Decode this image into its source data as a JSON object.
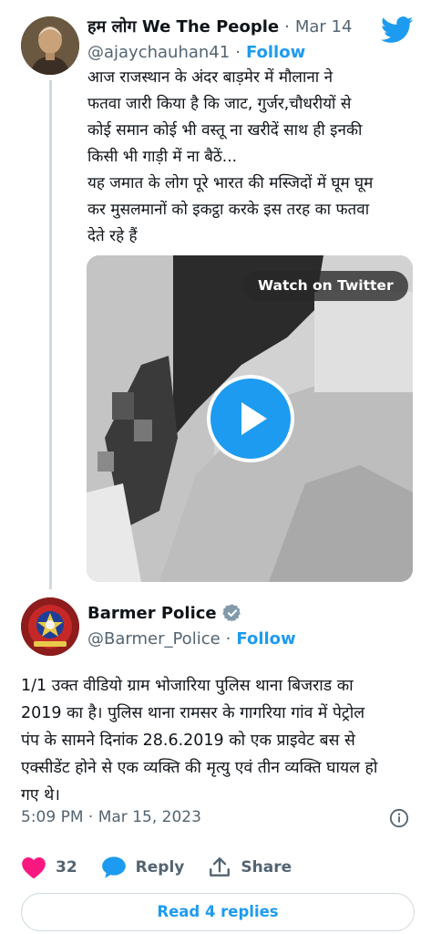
{
  "colors": {
    "brand": "#1d9bf0",
    "text": "#0f1419",
    "secondary": "#536471",
    "like": "#f91880",
    "border": "#cfd9de"
  },
  "icons": {
    "logo": "twitter-bird-icon",
    "verified": "verified-badge-icon",
    "info": "info-icon",
    "like": "heart-icon",
    "reply": "speech-bubble-icon",
    "share": "share-upload-icon",
    "play": "play-icon"
  },
  "quoted_tweet": {
    "display_name": "हम लोग We The People",
    "separator": "·",
    "date": "Mar 14",
    "handle": "@ajaychauhan41",
    "handle_separator": "·",
    "follow_label": "Follow",
    "text": "आज  राजस्थान के अंदर बाड़मेर में मौलाना ने\nफतवा जारी किया है कि जाट, गुर्जर,चौधरीयों से\nकोई समान कोई भी वस्तू ना खरीदें साथ ही इनकी\nकिसी भी गाड़ी में ना बैठें...\n यह जमात के लोग पूरे भारत की मस्जिदों में घूम घूम\nकर मुसलमानों को इकट्ठा करके इस तरह का फतवा\nदेते रहे हैं",
    "video": {
      "watch_label": "Watch on Twitter"
    }
  },
  "reply_tweet": {
    "display_name": "Barmer Police",
    "handle": "@Barmer_Police",
    "handle_separator": "·",
    "follow_label": "Follow",
    "text": "1/1 उक्त वीडियो ग्राम भोजारिया पुलिस थाना बिजराड का\n2019 का है। पुलिस थाना रामसर के गागरिया गांव में पेट्रोल\nपंप के सामने दिनांक 28.6.2019 को एक प्राइवेट बस से\nएक्सीडेंट होने से एक व्यक्ति की मृत्यु एवं तीन व्यक्ति घायल हो\nगए थे।",
    "timestamp": "5:09 PM · Mar 15, 2023",
    "like_count": "32",
    "reply_label": "Reply",
    "share_label": "Share",
    "read_replies_label": "Read 4 replies"
  }
}
